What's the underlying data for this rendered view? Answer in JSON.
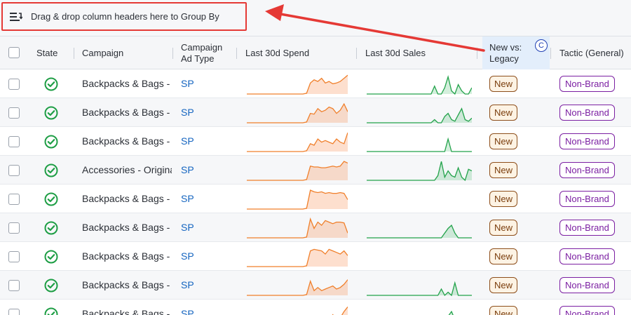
{
  "groupby": {
    "text": "Drag & drop column headers here to Group By",
    "icon": "group-by-icon"
  },
  "annotation": {
    "color": "#e53935"
  },
  "header": {
    "state": "State",
    "campaign": "Campaign",
    "adtype_line1": "Campaign",
    "adtype_line2": "Ad Type",
    "spend": "Last 30d Spend",
    "sales": "Last 30d Sales",
    "new_line1": "New vs:",
    "new_line2": "Legacy",
    "new_badge": "C",
    "tactic": "Tactic (General)"
  },
  "colors": {
    "spend": "#f07f2a",
    "sales": "#22a24a",
    "ok": "#1e9e45",
    "link": "#1565c0"
  },
  "rows": [
    {
      "campaign": "Backpacks & Bags - Laptop",
      "adtype": "SP",
      "new": "New",
      "tactic": "Non-Brand",
      "spend": [
        0,
        0,
        0,
        0,
        0,
        0,
        0,
        0,
        0,
        0,
        0,
        0,
        0,
        0,
        0,
        0,
        0.05,
        0.7,
        0.9,
        0.8,
        1,
        0.7,
        0.8,
        0.65,
        0.7,
        0.8,
        1.0,
        1.2
      ],
      "sales": [
        0,
        0,
        0,
        0,
        0,
        0,
        0,
        0,
        0,
        0,
        0,
        0,
        0,
        0,
        0,
        0,
        0,
        0,
        0,
        0,
        0.5,
        0,
        0,
        0.4,
        1.1,
        0.2,
        0,
        0.6,
        0.2,
        0,
        0,
        0.4
      ]
    },
    {
      "campaign": "Backpacks & Bags - Rolling",
      "adtype": "SP",
      "new": "New",
      "tactic": "Non-Brand",
      "spend": [
        0,
        0,
        0,
        0,
        0,
        0,
        0,
        0,
        0,
        0,
        0,
        0,
        0,
        0,
        0,
        0,
        0.05,
        0.6,
        0.55,
        0.9,
        0.7,
        0.8,
        1.0,
        0.9,
        0.6,
        0.8,
        1.2,
        0.7
      ],
      "sales": [
        0,
        0,
        0,
        0,
        0,
        0,
        0,
        0,
        0,
        0,
        0,
        0,
        0,
        0,
        0,
        0,
        0,
        0,
        0,
        0,
        0.2,
        0,
        0,
        0.4,
        0.6,
        0.2,
        0.1,
        0.5,
        0.9,
        0.2,
        0.1,
        0.3
      ]
    },
    {
      "campaign": "Backpacks & Bags - Travel",
      "adtype": "SP",
      "new": "New",
      "tactic": "Non-Brand",
      "spend": [
        0,
        0,
        0,
        0,
        0,
        0,
        0,
        0,
        0,
        0,
        0,
        0,
        0,
        0,
        0,
        0,
        0.05,
        0.5,
        0.4,
        0.8,
        0.6,
        0.7,
        0.6,
        0.5,
        0.8,
        0.6,
        0.5,
        1.2
      ],
      "sales": [
        0,
        0,
        0,
        0,
        0,
        0,
        0,
        0,
        0,
        0,
        0,
        0,
        0,
        0,
        0,
        0,
        0,
        0,
        0,
        0,
        0,
        0,
        0,
        0,
        0.8,
        0,
        0,
        0,
        0,
        0,
        0,
        0
      ]
    },
    {
      "campaign": "Accessories - Original",
      "adtype": "SP",
      "new": "New",
      "tactic": "Non-Brand",
      "spend": [
        0,
        0,
        0,
        0,
        0,
        0,
        0,
        0,
        0,
        0,
        0,
        0,
        0,
        0,
        0,
        0,
        0.05,
        0.9,
        0.85,
        0.85,
        0.8,
        0.8,
        0.85,
        0.9,
        0.85,
        0.9,
        1.2,
        1.1
      ],
      "sales": [
        0,
        0,
        0,
        0,
        0,
        0,
        0,
        0,
        0,
        0,
        0,
        0,
        0,
        0,
        0,
        0,
        0,
        0,
        0,
        0,
        0,
        0.3,
        1.2,
        0.2,
        0.6,
        0.3,
        0.2,
        0.8,
        0.2,
        0,
        0.7,
        0.6
      ]
    },
    {
      "campaign": "Backpacks & Bags - School",
      "adtype": "SP",
      "new": "New",
      "tactic": "Non-Brand",
      "spend": [
        0,
        0,
        0,
        0,
        0,
        0,
        0,
        0,
        0,
        0,
        0,
        0,
        0,
        0,
        0,
        0,
        0.05,
        1.2,
        1.1,
        1.05,
        1.1,
        1.0,
        1.05,
        1.0,
        1.0,
        1.05,
        1.0,
        0.6
      ],
      "sales": []
    },
    {
      "campaign": "Backpacks & Bags - Hiking",
      "adtype": "SP",
      "new": "New",
      "tactic": "Non-Brand",
      "spend": [
        0,
        0,
        0,
        0,
        0,
        0,
        0,
        0,
        0,
        0,
        0,
        0,
        0,
        0,
        0,
        0,
        0.05,
        1.2,
        0.6,
        1.0,
        0.8,
        1.1,
        1.0,
        0.9,
        1.0,
        1.0,
        0.95,
        0.3
      ],
      "sales": [
        0,
        0,
        0,
        0,
        0,
        0,
        0,
        0,
        0,
        0,
        0,
        0,
        0,
        0,
        0,
        0,
        0,
        0,
        0,
        0,
        0,
        0,
        0,
        0.3,
        0.6,
        0.8,
        0.3,
        0,
        0,
        0,
        0,
        0
      ]
    },
    {
      "campaign": "Backpacks & Bags - Duffel",
      "adtype": "SP",
      "new": "New",
      "tactic": "Non-Brand",
      "spend": [
        0,
        0,
        0,
        0,
        0,
        0,
        0,
        0,
        0,
        0,
        0,
        0,
        0,
        0,
        0,
        0,
        0.05,
        1.0,
        1.1,
        1.05,
        1.0,
        0.8,
        1.1,
        1.0,
        0.9,
        0.8,
        1.0,
        0.7
      ],
      "sales": []
    },
    {
      "campaign": "Backpacks & Bags - Messenger",
      "adtype": "SP",
      "new": "New",
      "tactic": "Non-Brand",
      "spend": [
        0,
        0,
        0,
        0,
        0,
        0,
        0,
        0,
        0,
        0,
        0,
        0,
        0,
        0,
        0,
        0,
        0.05,
        0.9,
        0.3,
        0.5,
        0.3,
        0.4,
        0.5,
        0.6,
        0.4,
        0.5,
        0.7,
        1.0
      ],
      "sales": [
        0,
        0,
        0,
        0,
        0,
        0,
        0,
        0,
        0,
        0,
        0,
        0,
        0,
        0,
        0,
        0,
        0,
        0,
        0,
        0,
        0,
        0,
        0.4,
        0,
        0.2,
        0,
        0.8,
        0,
        0,
        0,
        0,
        0
      ]
    },
    {
      "campaign": "Backpacks & Bags - Kids",
      "adtype": "SP",
      "new": "New",
      "tactic": "Non-Brand",
      "spend": [
        0,
        0,
        0,
        0,
        0,
        0,
        0,
        0,
        0,
        0,
        0,
        0,
        0,
        0,
        0,
        0,
        0.05,
        0.4,
        0.2,
        0.3,
        0.5,
        0.3,
        0.2,
        0.6,
        0.3,
        0.4,
        0.8,
        1.1
      ],
      "sales": [
        0,
        0,
        0,
        0,
        0,
        0,
        0,
        0,
        0,
        0,
        0,
        0,
        0,
        0,
        0,
        0,
        0,
        0,
        0,
        0,
        0,
        0,
        0,
        0,
        0.5,
        0.8,
        0.3,
        0,
        0,
        0,
        0,
        0
      ]
    }
  ]
}
